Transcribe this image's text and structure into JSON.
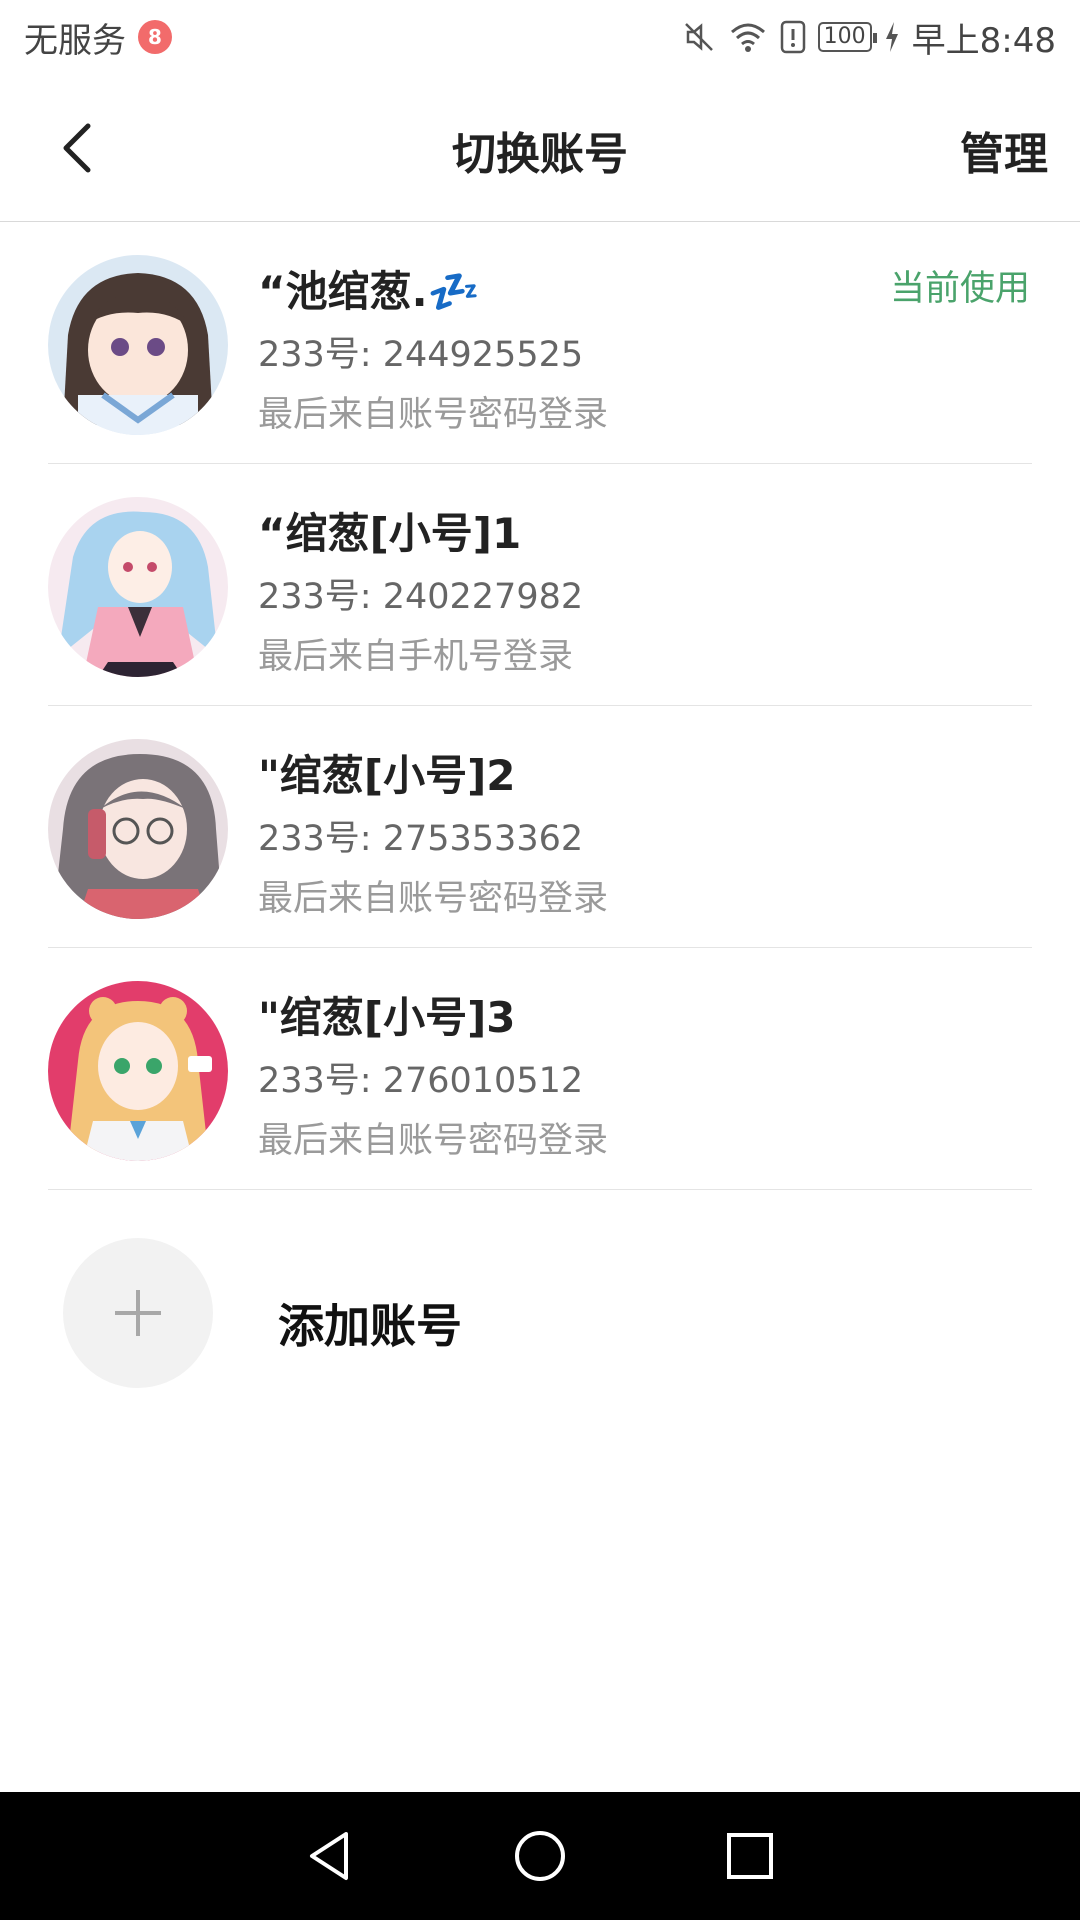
{
  "status_bar": {
    "carrier": "无服务",
    "time": "早上8:48",
    "battery": "100",
    "icons": [
      "mute-icon",
      "wifi-icon",
      "sim-alert-icon",
      "battery-icon",
      "charging-icon"
    ]
  },
  "header": {
    "back_icon": "chevron-left-icon",
    "title": "切换账号",
    "manage_label": "管理"
  },
  "accounts": [
    {
      "name": "“池绾葱.💤",
      "id_text": "233号: 244925525",
      "login_text": "最后来自账号密码登录",
      "current_label": "当前使用",
      "is_current": true
    },
    {
      "name": "“绾葱[小号]1",
      "id_text": "233号: 240227982",
      "login_text": "最后来自手机号登录",
      "is_current": false
    },
    {
      "name": "\"绾葱[小号]2",
      "id_text": "233号: 275353362",
      "login_text": "最后来自账号密码登录",
      "is_current": false
    },
    {
      "name": "\"绾葱[小号]3",
      "id_text": "233号: 276010512",
      "login_text": "最后来自账号密码登录",
      "is_current": false
    }
  ],
  "add_account": {
    "icon": "plus-icon",
    "label": "添加账号"
  },
  "nav_bar": {
    "icons": [
      "back-triangle-icon",
      "home-circle-icon",
      "recents-square-icon"
    ]
  },
  "colors": {
    "accent_green": "#4aa36b",
    "divider": "#e4e4e4",
    "nav_bg": "#000000"
  }
}
